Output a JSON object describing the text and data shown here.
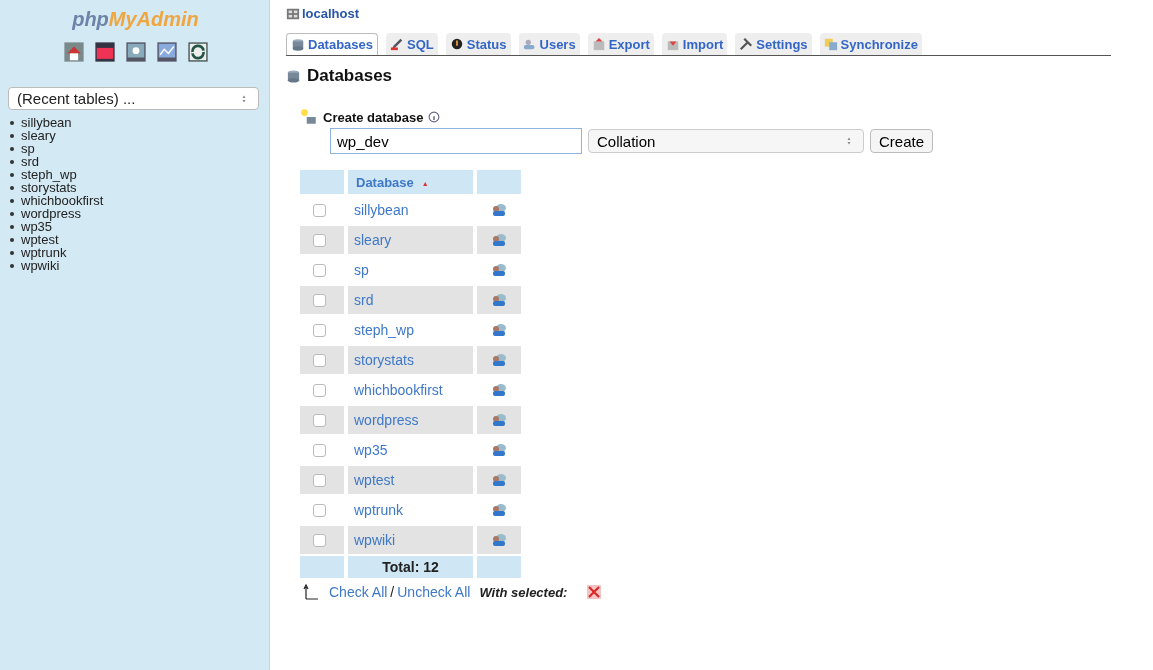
{
  "sidebar": {
    "logo": {
      "part_1": "php",
      "part_2": "MyAdmin"
    },
    "recent_select": {
      "value": "(Recent tables) ..."
    },
    "databases": [
      "sillybean",
      "sleary",
      "sp",
      "srd",
      "steph_wp",
      "storystats",
      "whichbookfirst",
      "wordpress",
      "wp35",
      "wptest",
      "wptrunk",
      "wpwiki"
    ]
  },
  "breadcrumb": "localhost",
  "tabs": [
    {
      "label": "Databases",
      "selected": true
    },
    {
      "label": "SQL",
      "selected": false
    },
    {
      "label": "Status",
      "selected": false
    },
    {
      "label": "Users",
      "selected": false
    },
    {
      "label": "Export",
      "selected": false
    },
    {
      "label": "Import",
      "selected": false
    },
    {
      "label": "Settings",
      "selected": false
    },
    {
      "label": "Synchronize",
      "selected": false
    }
  ],
  "page_title": "Databases",
  "create_database": {
    "label": "Create database",
    "name_value": "wp_dev",
    "collation_value": "Collation",
    "button": "Create"
  },
  "table": {
    "columns": [
      "Database"
    ],
    "sort_mark": "▲",
    "rows": [
      {
        "name": "sillybean",
        "checked": false
      },
      {
        "name": "sleary",
        "checked": false
      },
      {
        "name": "sp",
        "checked": false
      },
      {
        "name": "srd",
        "checked": false
      },
      {
        "name": "steph_wp",
        "checked": false
      },
      {
        "name": "storystats",
        "checked": false
      },
      {
        "name": "whichbookfirst",
        "checked": false
      },
      {
        "name": "wordpress",
        "checked": false
      },
      {
        "name": "wp35",
        "checked": false
      },
      {
        "name": "wptest",
        "checked": false
      },
      {
        "name": "wptrunk",
        "checked": false
      },
      {
        "name": "wpwiki",
        "checked": false
      }
    ],
    "total": "Total: 12"
  },
  "footer": {
    "check_all": "Check All",
    "separator": "/",
    "uncheck_all": "Uncheck All",
    "with_selected": "With selected:"
  }
}
